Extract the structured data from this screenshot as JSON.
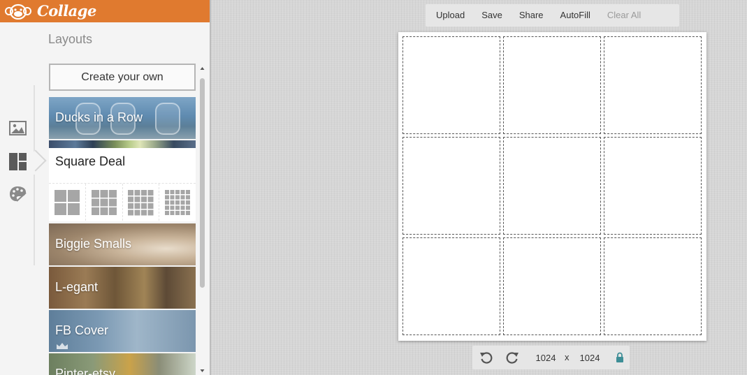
{
  "brand": {
    "name": "Collage"
  },
  "sidebar": {
    "panel_title": "Layouts",
    "create_button": "Create your own",
    "layouts": [
      {
        "name": "Ducks in a Row"
      },
      {
        "name": "Square Deal",
        "expanded": true,
        "grid_options": [
          "2x2",
          "3x3",
          "4x4",
          "5x5"
        ]
      },
      {
        "name": "Biggie Smalls"
      },
      {
        "name": "L-egant"
      },
      {
        "name": "FB Cover",
        "premium_icon": "crown-icon"
      },
      {
        "name": "Pinter-etsy"
      }
    ],
    "rail_icons": [
      "image-icon",
      "layouts-icon",
      "palette-icon"
    ]
  },
  "toolbar": {
    "upload": "Upload",
    "save": "Save",
    "share": "Share",
    "autofill": "AutoFill",
    "clear_all": "Clear All"
  },
  "canvas": {
    "grid": "3x3",
    "cell_count": 9
  },
  "size_bar": {
    "width": "1024",
    "height": "1024",
    "separator": "x",
    "icons": [
      "rotate-left-icon",
      "rotate-right-icon",
      "lock-icon"
    ]
  },
  "colors": {
    "brand_orange": "#e07a2f",
    "lock_teal": "#3e8e96",
    "disabled_text": "#9a9a9a"
  }
}
